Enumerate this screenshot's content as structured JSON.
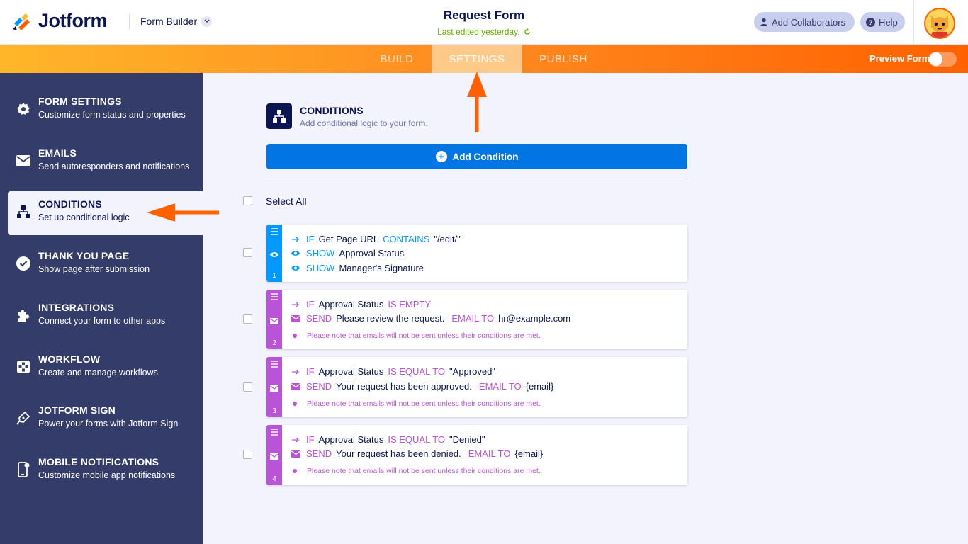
{
  "header": {
    "logo_text": "Jotform",
    "builder_label": "Form Builder",
    "form_title": "Request Form",
    "last_edited": "Last edited yesterday.",
    "add_collaborators": "Add Collaborators",
    "help": "Help"
  },
  "nav": {
    "tabs": [
      {
        "label": "BUILD"
      },
      {
        "label": "SETTINGS"
      },
      {
        "label": "PUBLISH"
      }
    ],
    "active_tab": "SETTINGS",
    "preview_label": "Preview Form"
  },
  "sidebar": {
    "items": [
      {
        "title": "FORM SETTINGS",
        "desc": "Customize form status and properties",
        "icon": "gear-icon"
      },
      {
        "title": "EMAILS",
        "desc": "Send autoresponders and notifications",
        "icon": "envelope-icon"
      },
      {
        "title": "CONDITIONS",
        "desc": "Set up conditional logic",
        "icon": "hierarchy-icon"
      },
      {
        "title": "THANK YOU PAGE",
        "desc": "Show page after submission",
        "icon": "check-circle-icon"
      },
      {
        "title": "INTEGRATIONS",
        "desc": "Connect your form to other apps",
        "icon": "puzzle-icon"
      },
      {
        "title": "WORKFLOW",
        "desc": "Create and manage workflows",
        "icon": "workflow-icon"
      },
      {
        "title": "JOTFORM SIGN",
        "desc": "Power your forms with Jotform Sign",
        "icon": "pen-icon"
      },
      {
        "title": "MOBILE NOTIFICATIONS",
        "desc": "Customize mobile app notifications",
        "icon": "mobile-icon"
      }
    ],
    "active_item": "CONDITIONS"
  },
  "main": {
    "section_title": "CONDITIONS",
    "section_desc": "Add conditional logic to your form.",
    "add_condition": "Add Condition",
    "select_all": "Select All",
    "conditions": [
      {
        "number": "1",
        "type": "show",
        "color": "#0099ff",
        "if_field": "Get Page URL",
        "if_operator": "CONTAINS",
        "if_value": "\"/edit/\"",
        "actions": [
          {
            "keyword": "SHOW",
            "target": "Approval Status"
          },
          {
            "keyword": "SHOW",
            "target": "Manager's Signature"
          }
        ]
      },
      {
        "number": "2",
        "type": "email",
        "color": "#b954d6",
        "if_field": "Approval Status",
        "if_operator": "IS EMPTY",
        "if_value": "",
        "send_keyword": "SEND",
        "send_subject": "Please review the request.",
        "email_to_keyword": "EMAIL TO",
        "email_to": "hr@example.com",
        "note": "Please note that emails will not be sent unless their conditions are met."
      },
      {
        "number": "3",
        "type": "email",
        "color": "#b954d6",
        "if_field": "Approval Status",
        "if_operator": "IS EQUAL TO",
        "if_value": "\"Approved\"",
        "send_keyword": "SEND",
        "send_subject": "Your request has been approved.",
        "email_to_keyword": "EMAIL TO",
        "email_to": "{email}",
        "note": "Please note that emails will not be sent unless their conditions are met."
      },
      {
        "number": "4",
        "type": "email",
        "color": "#b954d6",
        "if_field": "Approval Status",
        "if_operator": "IS EQUAL TO",
        "if_value": "\"Denied\"",
        "send_keyword": "SEND",
        "send_subject": "Your request has been denied.",
        "email_to_keyword": "EMAIL TO",
        "email_to": "{email}",
        "note": "Please note that emails will not be sent unless their conditions are met."
      }
    ],
    "if_keyword": "IF"
  },
  "colors": {
    "brand_orange": "#ff6100",
    "sidebar_bg": "#343c6a",
    "primary_blue": "#0075e3",
    "show_blue": "#0099ff",
    "email_purple": "#b954d6",
    "annotation_arrow": "#ff6100"
  }
}
